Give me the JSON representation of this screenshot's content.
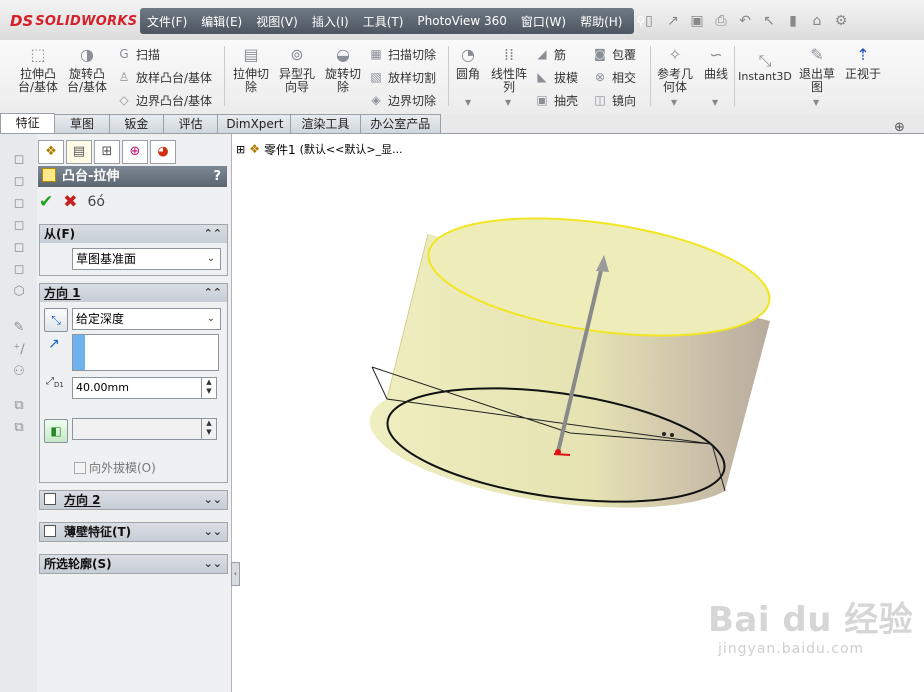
{
  "app": {
    "logo_mark": "DS",
    "logo_text": "SOLIDWORKS"
  },
  "menu": [
    "文件(F)",
    "编辑(E)",
    "视图(V)",
    "插入(I)",
    "工具(T)",
    "PhotoView 360",
    "窗口(W)",
    "帮助(H)"
  ],
  "ribbon": {
    "extrude_boss": "拉伸凸\n台/基体",
    "revolve_boss": "旋转凸\n台/基体",
    "sweep": "扫描",
    "loft": "放样凸台/基体",
    "boundary_boss": "边界凸台/基体",
    "extrude_cut": "拉伸切\n除",
    "hole_wizard": "异型孔\n向导",
    "revolve_cut": "旋转切\n除",
    "swept_cut": "扫描切除",
    "lofted_cut": "放样切割",
    "boundary_cut": "边界切除",
    "fillet": "圆角",
    "linear_pattern": "线性阵\n列",
    "rib": "筋",
    "draft": "拔模",
    "shell": "抽壳",
    "wrap": "包覆",
    "intersect": "相交",
    "mirror": "镜向",
    "ref_geometry": "参考几\n何体",
    "curves": "曲线",
    "instant3d": "Instant3D",
    "exit_sketch": "退出草\n图",
    "normal_to": "正视于"
  },
  "tabs": [
    "特征",
    "草图",
    "钣金",
    "评估",
    "DimXpert",
    "渲染工具",
    "办公室产品"
  ],
  "active_tab": "特征",
  "property_manager": {
    "title": "凸台-拉伸",
    "help": "?",
    "from": {
      "header": "从(F)",
      "value": "草图基准面"
    },
    "direction1": {
      "header": "方向 1",
      "end_condition": "给定深度",
      "depth": "40.00mm",
      "depth_icon_label": "D1",
      "draft_outward": "向外拔模(O)"
    },
    "direction2": {
      "header": "方向 2"
    },
    "thin_feature": {
      "header": "薄壁特征(T)"
    },
    "selected_contours": {
      "header": "所选轮廓(S)"
    }
  },
  "tree": {
    "part_label": "零件1",
    "config_label": "(默认<<默认>_显..."
  },
  "watermark": {
    "main": "Bai du 经验",
    "sub": "jingyan.baidu.com"
  },
  "colors": {
    "brand_red": "#d4202a",
    "menubar": "#5a636d",
    "cylinder_fill": "#ecebb4",
    "cylinder_edge": "#f2e622"
  },
  "icons": {
    "ok": "check-icon",
    "cancel": "cross-icon",
    "preview": "glasses-icon"
  }
}
